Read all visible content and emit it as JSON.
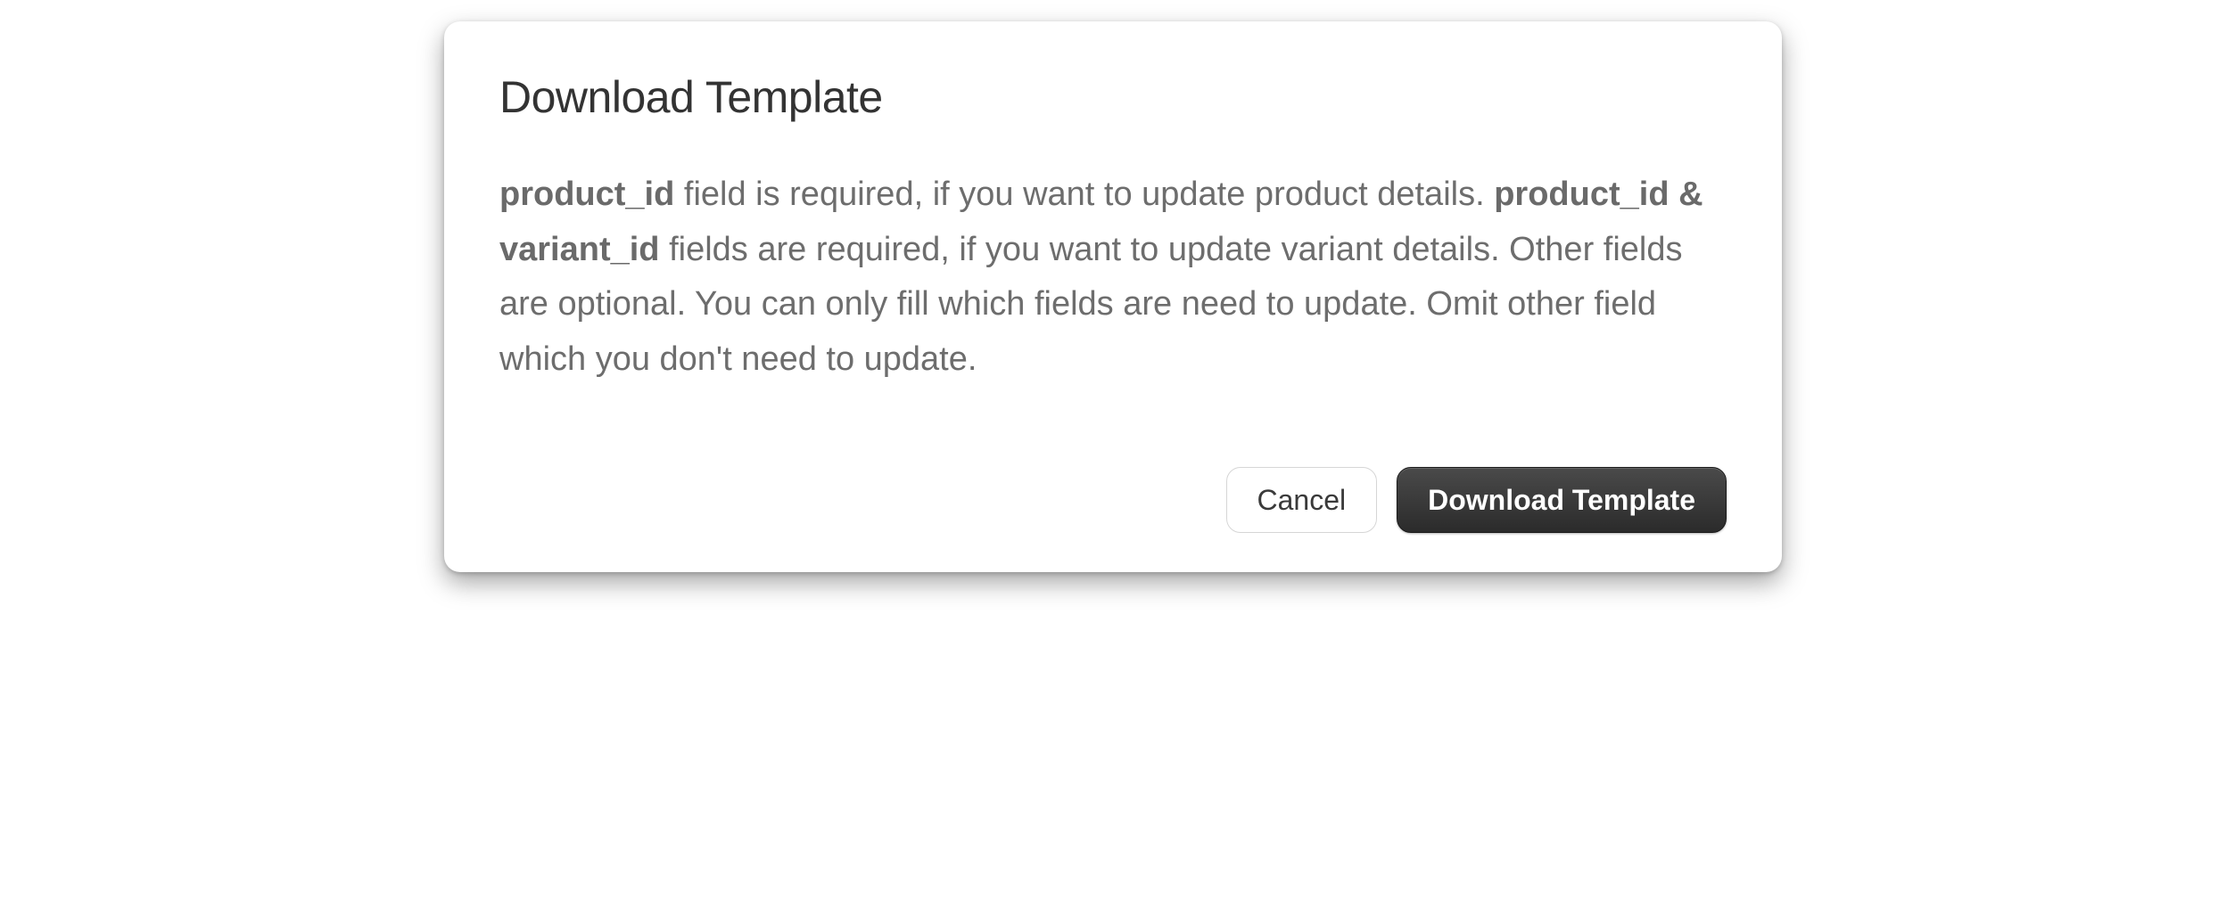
{
  "dialog": {
    "title": "Download Template",
    "body": {
      "bold1": "product_id",
      "text1": " field is required, if you want to update product details. ",
      "bold2": "product_id & variant_id",
      "text2": " fields are required, if you want to update variant details. Other fields are optional. You can only fill which fields are need to update. Omit other field which you don't need to update."
    },
    "buttons": {
      "cancel": "Cancel",
      "download": "Download Template"
    }
  }
}
